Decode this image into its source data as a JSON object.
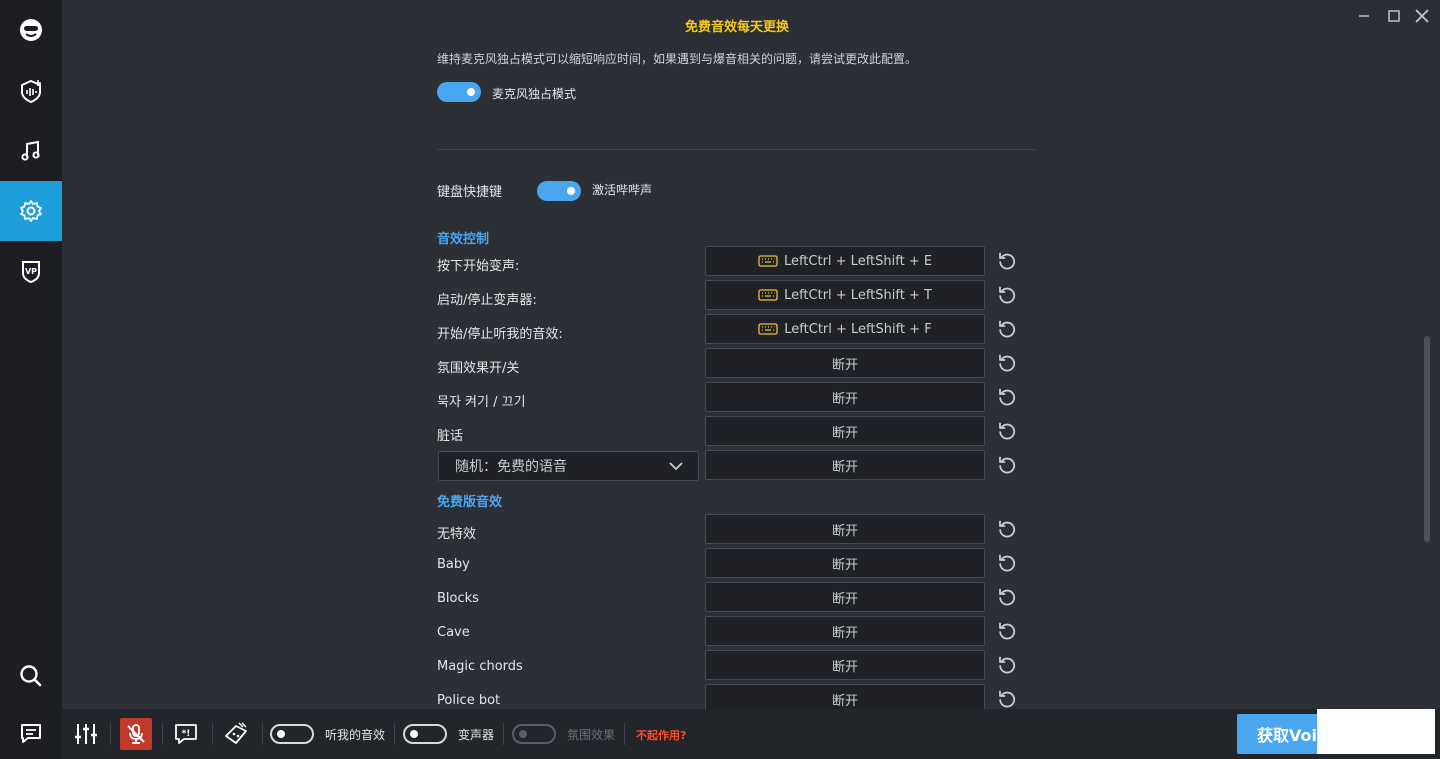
{
  "header": {
    "title": "免费音效每天更换"
  },
  "mic_exclusive": {
    "description": "维持麦克风独占模式可以缩短响应时间，如果遇到与爆音相关的问题，请尝试更改此配置。",
    "toggle_label": "麦克风独占模式",
    "enabled": true
  },
  "keyboard": {
    "label": "键盘快捷键",
    "beep_label": "激活哔哔声",
    "beep_enabled": true
  },
  "sections": {
    "sound_control": "音效控制",
    "free_effects": "免费版音效"
  },
  "sound_control_rows": [
    {
      "label": "按下开始变声:",
      "shortcut": "LeftCtrl + LeftShift + E",
      "has_key_icon": true
    },
    {
      "label": "启动/停止变声器:",
      "shortcut": "LeftCtrl + LeftShift + T",
      "has_key_icon": true
    },
    {
      "label": "开始/停止听我的音效:",
      "shortcut": "LeftCtrl + LeftShift + F",
      "has_key_icon": true
    },
    {
      "label": "氛围效果开/关",
      "shortcut": "断开",
      "has_key_icon": false
    },
    {
      "label": "묵자 켜기 / 끄기",
      "shortcut": "断开",
      "has_key_icon": false
    },
    {
      "label": "脏话",
      "shortcut": "断开",
      "has_key_icon": false
    }
  ],
  "random_dropdown": {
    "value": "随机：免费的语音",
    "shortcut": "断开"
  },
  "free_effect_rows": [
    {
      "label": "无特效",
      "shortcut": "断开"
    },
    {
      "label": "Baby",
      "shortcut": "断开"
    },
    {
      "label": "Blocks",
      "shortcut": "断开"
    },
    {
      "label": "Cave",
      "shortcut": "断开"
    },
    {
      "label": "Magic chords",
      "shortcut": "断开"
    },
    {
      "label": "Police bot",
      "shortcut": "断开"
    }
  ],
  "bottom_bar": {
    "hear_myself_label": "听我的音效",
    "voice_changer_label": "变声器",
    "ambience_label": "氛围效果",
    "not_working_label": "不起作用?",
    "get_button_label": "获取Voicemod Pro"
  },
  "colors": {
    "accent": "#1e9fdc",
    "toggle_on": "#4aa6ee",
    "title": "#f3c71b",
    "warning": "#ff4a2e",
    "mic_muted": "#c0392b"
  }
}
